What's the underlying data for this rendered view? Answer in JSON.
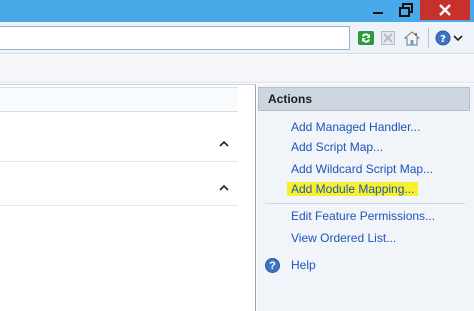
{
  "window": {
    "minimize_icon": "minimize-icon",
    "maximize_icon": "restore-icon",
    "close_icon": "close-icon"
  },
  "toolbar": {
    "icons": [
      "refresh-icon",
      "stop-icon",
      "home-icon",
      "help-icon"
    ]
  },
  "actions": {
    "title": "Actions",
    "items": [
      {
        "label": "Add Managed Handler..."
      },
      {
        "label": "Add Script Map..."
      },
      {
        "label": "Add Wildcard Script Map..."
      },
      {
        "label": "Add Module Mapping...",
        "highlighted": true
      },
      {
        "label": "Edit Feature Permissions..."
      },
      {
        "label": "View Ordered List..."
      }
    ],
    "help_label": "Help"
  },
  "colors": {
    "titlebar": "#4aa9e8",
    "close_button": "#c7302b",
    "link": "#1f55b8",
    "highlight": "#f7f02e"
  }
}
